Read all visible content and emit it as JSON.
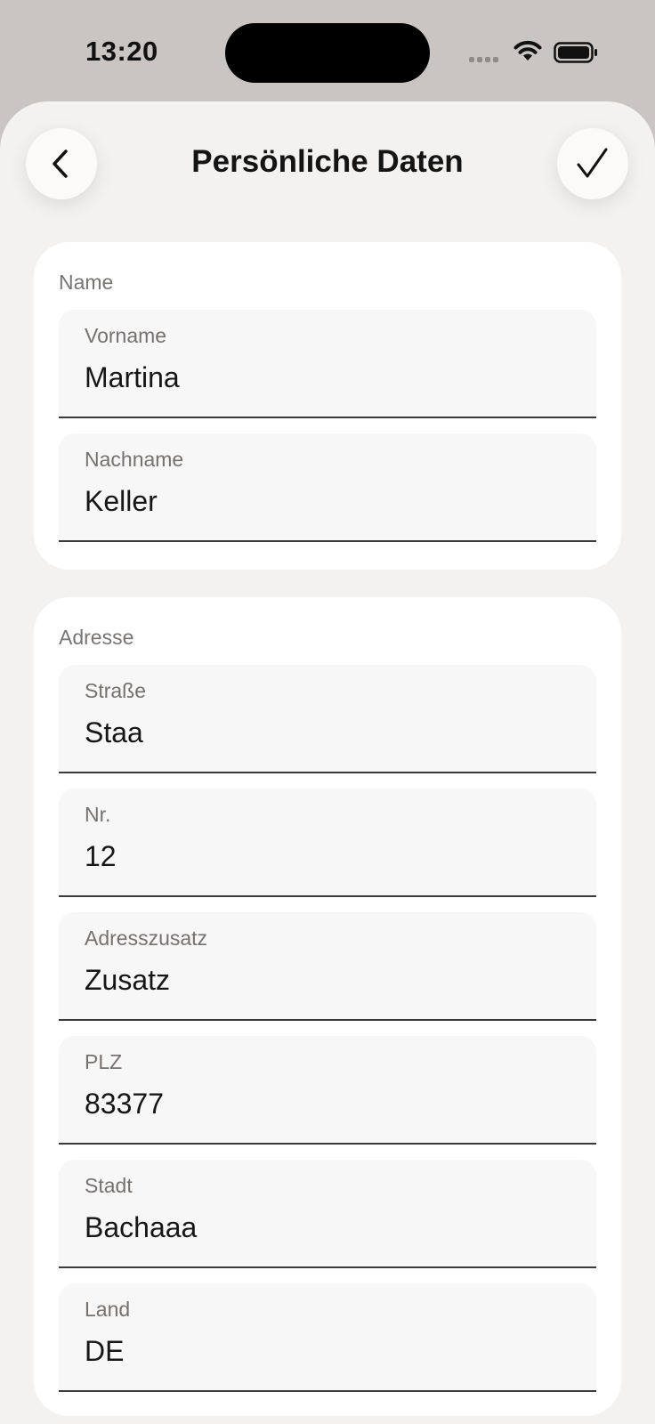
{
  "status_bar": {
    "time": "13:20"
  },
  "header": {
    "title": "Persönliche Daten",
    "back_icon": "chevron-left-icon",
    "confirm_icon": "checkmark-icon"
  },
  "name_section": {
    "label": "Name",
    "fields": [
      {
        "label": "Vorname",
        "value": "Martina"
      },
      {
        "label": "Nachname",
        "value": "Keller"
      }
    ]
  },
  "address_section": {
    "label": "Adresse",
    "fields": [
      {
        "label": "Straße",
        "value": "Staa"
      },
      {
        "label": "Nr.",
        "value": "12"
      },
      {
        "label": "Adresszusatz",
        "value": "Zusatz"
      },
      {
        "label": "PLZ",
        "value": "83377"
      },
      {
        "label": "Stadt",
        "value": "Bachaaa"
      },
      {
        "label": "Land",
        "value": "DE"
      }
    ]
  },
  "colors": {
    "background": "#c8c5c3",
    "sheet": "#f3f2f1",
    "card": "#ffffff",
    "field_fill": "#f8f7f7",
    "text": "#161616",
    "muted": "#74716f"
  }
}
